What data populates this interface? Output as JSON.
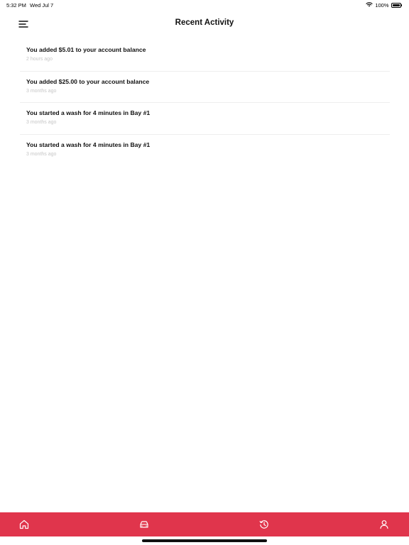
{
  "status_bar": {
    "time": "5:32 PM",
    "date": "Wed Jul 7",
    "battery": "100%"
  },
  "header": {
    "title": "Recent Activity"
  },
  "activities": [
    {
      "text": "You added $5.01 to your account balance",
      "time": "2 hours ago"
    },
    {
      "text": "You added $25.00 to your account balance",
      "time": "3 months ago"
    },
    {
      "text": "You started a wash for 4 minutes in Bay #1",
      "time": "3 months ago"
    },
    {
      "text": "You started a wash for 4 minutes in Bay #1",
      "time": "3 months ago"
    }
  ],
  "bottom_nav": {
    "items": [
      {
        "icon": "home-icon"
      },
      {
        "icon": "car-icon"
      },
      {
        "icon": "history-icon"
      },
      {
        "icon": "profile-icon"
      }
    ]
  },
  "colors": {
    "accent": "#e0354c",
    "text": "#111111",
    "muted": "#c6c6c6",
    "divider": "#eeeeee"
  }
}
